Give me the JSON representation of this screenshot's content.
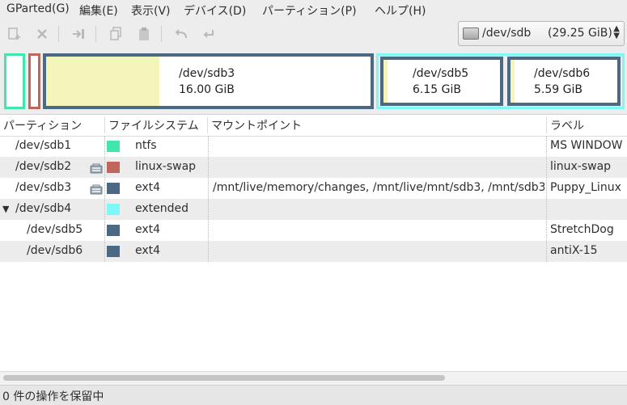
{
  "menu": [
    "GParted(G)",
    "編集(E)",
    "表示(V)",
    "デバイス(D)",
    "パーティション(P)",
    "ヘルプ(H)"
  ],
  "toolbar": {
    "icons": [
      "new-partition-icon",
      "delete-icon",
      "resize-move-icon",
      "copy-icon",
      "paste-icon",
      "undo-icon",
      "apply-icon"
    ]
  },
  "device": {
    "name": "/dev/sdb",
    "size": "(29.25 GiB)"
  },
  "map": {
    "sdb3": {
      "name": "/dev/sdb3",
      "size": "16.00 GiB"
    },
    "sdb5": {
      "name": "/dev/sdb5",
      "size": "6.15 GiB"
    },
    "sdb6": {
      "name": "/dev/sdb6",
      "size": "5.59 GiB"
    }
  },
  "columns": {
    "partition": "パーティション",
    "filesystem": "ファイルシステム",
    "mountpoint": "マウントポイント",
    "label": "ラベル"
  },
  "rows": [
    {
      "partition": "/dev/sdb1",
      "filesystem": "ntfs",
      "mountpoint": "",
      "label": "MS WINDOW",
      "color": "#42e5ac",
      "locked": false,
      "indent": 0,
      "expander": ""
    },
    {
      "partition": "/dev/sdb2",
      "filesystem": "linux-swap",
      "mountpoint": "",
      "label": "linux-swap",
      "color": "#c1665a",
      "locked": true,
      "indent": 0,
      "expander": ""
    },
    {
      "partition": "/dev/sdb3",
      "filesystem": "ext4",
      "mountpoint": "/mnt/live/memory/changes, /mnt/live/mnt/sdb3, /mnt/sdb3",
      "label": "Puppy_Linux",
      "color": "#4b6983",
      "locked": true,
      "indent": 0,
      "expander": ""
    },
    {
      "partition": "/dev/sdb4",
      "filesystem": "extended",
      "mountpoint": "",
      "label": "",
      "color": "#7ef7f7",
      "locked": false,
      "indent": 0,
      "expander": "▼"
    },
    {
      "partition": "/dev/sdb5",
      "filesystem": "ext4",
      "mountpoint": "",
      "label": "StretchDog",
      "color": "#4b6983",
      "locked": false,
      "indent": 1,
      "expander": ""
    },
    {
      "partition": "/dev/sdb6",
      "filesystem": "ext4",
      "mountpoint": "",
      "label": "antiX-15",
      "color": "#4b6983",
      "locked": false,
      "indent": 1,
      "expander": ""
    }
  ],
  "status": "0 件の操作を保留中",
  "colors": {
    "ntfs": "#42e5ac",
    "swap": "#c1665a",
    "ext4": "#4b6983",
    "extended": "#7ef7f7",
    "used": "#f4f5bb"
  }
}
